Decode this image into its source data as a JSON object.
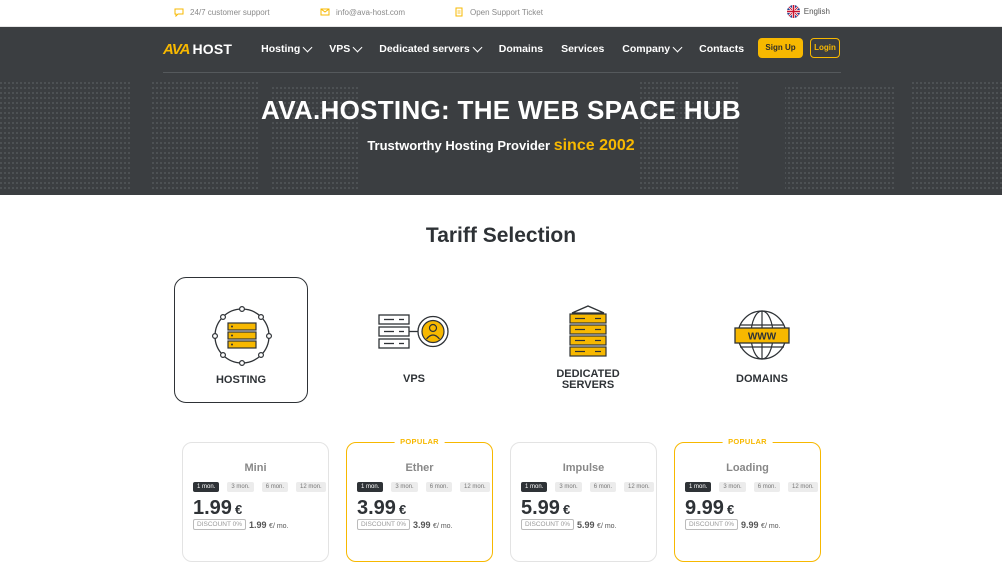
{
  "topbar": {
    "support": "24/7 customer support",
    "email": "info@ava-host.com",
    "ticket": "Open Support Ticket",
    "language": "English"
  },
  "header": {
    "logo_mark": "AVA",
    "logo_text": "HOST",
    "menu": [
      {
        "label": "Hosting",
        "dropdown": true
      },
      {
        "label": "VPS",
        "dropdown": true
      },
      {
        "label": "Dedicated servers",
        "dropdown": true
      },
      {
        "label": "Domains",
        "dropdown": false
      },
      {
        "label": "Services",
        "dropdown": false
      },
      {
        "label": "Company",
        "dropdown": true
      },
      {
        "label": "Contacts",
        "dropdown": false
      }
    ],
    "signup_label": "Sign Up",
    "login_label": "Login"
  },
  "hero": {
    "title": "AVA.HOSTING: THE WEB SPACE HUB",
    "subtitle_prefix": "Trustworthy Hosting Provider",
    "subtitle_since": "since 2002"
  },
  "tariff": {
    "title": "Tariff Selection",
    "categories": [
      {
        "label": "HOSTING",
        "icon": "hosting-icon",
        "active": true
      },
      {
        "label": "VPS",
        "icon": "vps-icon",
        "active": false
      },
      {
        "label_line1": "DEDICATED",
        "label_line2": "SERVERS",
        "icon": "dedicated-servers-icon",
        "active": false
      },
      {
        "label": "DOMAINS",
        "icon": "domains-icon",
        "active": false
      }
    ],
    "plans": [
      {
        "name": "Mini",
        "popular": false,
        "periods": [
          "1 mon.",
          "3 mon.",
          "6 mon.",
          "12 mon."
        ],
        "price": "1.99",
        "currency": "€",
        "discount": "DISCOUNT 0%",
        "old_price": "1.99",
        "unit": "€/ mo."
      },
      {
        "name": "Ether",
        "popular": true,
        "badge": "POPULAR",
        "periods": [
          "1 mon.",
          "3 mon.",
          "6 mon.",
          "12 mon."
        ],
        "price": "3.99",
        "currency": "€",
        "discount": "DISCOUNT 0%",
        "old_price": "3.99",
        "unit": "€/ mo."
      },
      {
        "name": "Impulse",
        "popular": false,
        "periods": [
          "1 mon.",
          "3 mon.",
          "6 mon.",
          "12 mon."
        ],
        "price": "5.99",
        "currency": "€",
        "discount": "DISCOUNT 0%",
        "old_price": "5.99",
        "unit": "€/ mo."
      },
      {
        "name": "Loading",
        "popular": true,
        "badge": "POPULAR",
        "periods": [
          "1 mon.",
          "3 mon.",
          "6 mon.",
          "12 mon."
        ],
        "price": "9.99",
        "currency": "€",
        "discount": "DISCOUNT 0%",
        "old_price": "9.99",
        "unit": "€/ mo."
      }
    ]
  },
  "colors": {
    "accent": "#f7b800",
    "dark": "#3b3e41",
    "text": "#2e3236"
  }
}
